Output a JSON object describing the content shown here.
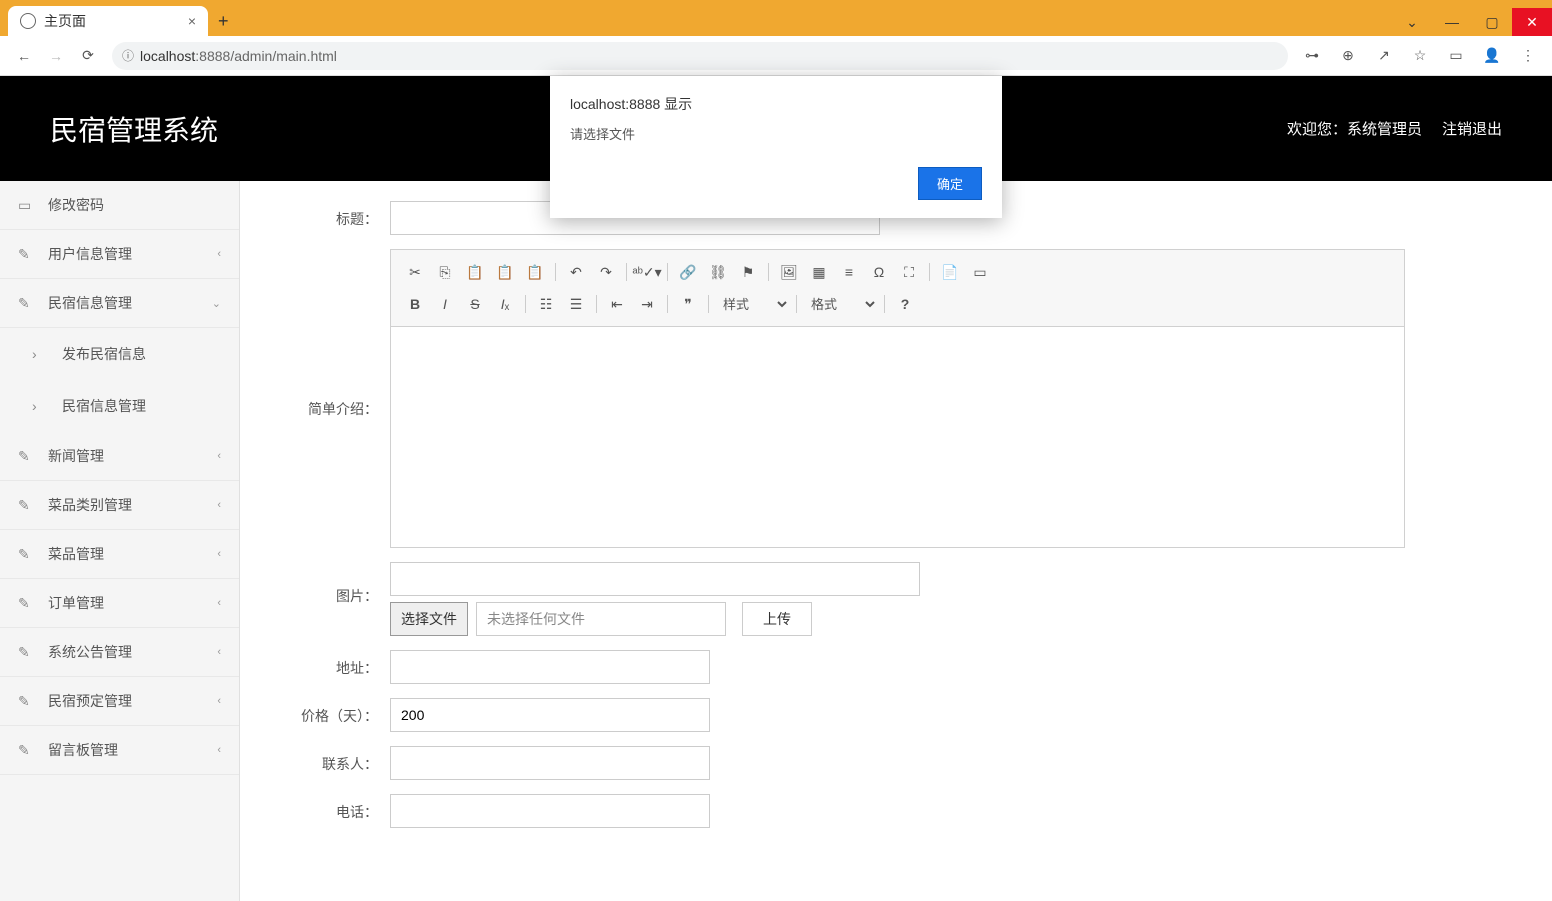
{
  "browser": {
    "tab_title": "主页面",
    "url_prefix": "localhost",
    "url_suffix": ":8888/admin/main.html",
    "url_info_icon": "ⓘ"
  },
  "header": {
    "app_title": "民宿管理系统",
    "welcome_prefix": "欢迎您：",
    "welcome_user": "系统管理员",
    "logout": "注销退出"
  },
  "sidebar": {
    "items": [
      {
        "label": "修改密码",
        "chevron": ""
      },
      {
        "label": "用户信息管理",
        "chevron": "‹"
      },
      {
        "label": "民宿信息管理",
        "chevron": "⌄",
        "expanded": true,
        "children": [
          {
            "label": "发布民宿信息"
          },
          {
            "label": "民宿信息管理"
          }
        ]
      },
      {
        "label": "新闻管理",
        "chevron": "‹"
      },
      {
        "label": "菜品类别管理",
        "chevron": "‹"
      },
      {
        "label": "菜品管理",
        "chevron": "‹"
      },
      {
        "label": "订单管理",
        "chevron": "‹"
      },
      {
        "label": "系统公告管理",
        "chevron": "‹"
      },
      {
        "label": "民宿预定管理",
        "chevron": "‹"
      },
      {
        "label": "留言板管理",
        "chevron": "‹"
      }
    ]
  },
  "form": {
    "title_label": "标题：",
    "intro_label": "简单介绍：",
    "image_label": "图片：",
    "choose_file": "选择文件",
    "no_file": "未选择任何文件",
    "upload": "上传",
    "address_label": "地址：",
    "price_label": "价格（天）：",
    "price_value": "200",
    "contact_label": "联系人：",
    "phone_label": "电话："
  },
  "editor": {
    "style_select": "样式",
    "format_select": "格式"
  },
  "dialog": {
    "title": "localhost:8888 显示",
    "message": "请选择文件",
    "ok": "确定"
  }
}
